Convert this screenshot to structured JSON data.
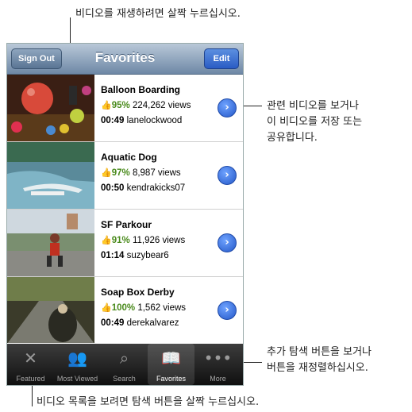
{
  "callouts": {
    "top": "비디오를 재생하려면 살짝 누르십시오.",
    "right_top_1": "관련 비디오를 보거나",
    "right_top_2": "이 비디오를 저장 또는",
    "right_top_3": "공유합니다.",
    "right_bottom_1": "추가 탐색 버튼을 보거나",
    "right_bottom_2": "버튼을 재정렬하십시오.",
    "bottom": "비디오 목록을 보려면 탐색 버튼을 살짝 누르십시오."
  },
  "navbar": {
    "title": "Favorites",
    "left_button": "Sign Out",
    "right_button": "Edit"
  },
  "videos": [
    {
      "title": "Balloon Boarding",
      "rating": "95%",
      "views": "224,262 views",
      "duration": "00:49",
      "user": "lanelockwood"
    },
    {
      "title": "Aquatic Dog",
      "rating": "97%",
      "views": "8,987 views",
      "duration": "00:50",
      "user": "kendrakicks07"
    },
    {
      "title": "SF Parkour",
      "rating": "91%",
      "views": "11,926 views",
      "duration": "01:14",
      "user": "suzybear6"
    },
    {
      "title": "Soap Box Derby",
      "rating": "100%",
      "views": "1,562 views",
      "duration": "00:49",
      "user": "derekalvarez"
    }
  ],
  "tabbar": {
    "tabs": [
      {
        "label": "Featured",
        "icon": "featured-icon"
      },
      {
        "label": "Most Viewed",
        "icon": "most-viewed-icon"
      },
      {
        "label": "Search",
        "icon": "search-icon"
      },
      {
        "label": "Favorites",
        "icon": "favorites-book-icon",
        "active": true
      },
      {
        "label": "More",
        "icon": "more-dots-icon"
      }
    ]
  },
  "colors": {
    "rating_green": "#4a8a1c",
    "accent_blue": "#2a5cc4"
  }
}
